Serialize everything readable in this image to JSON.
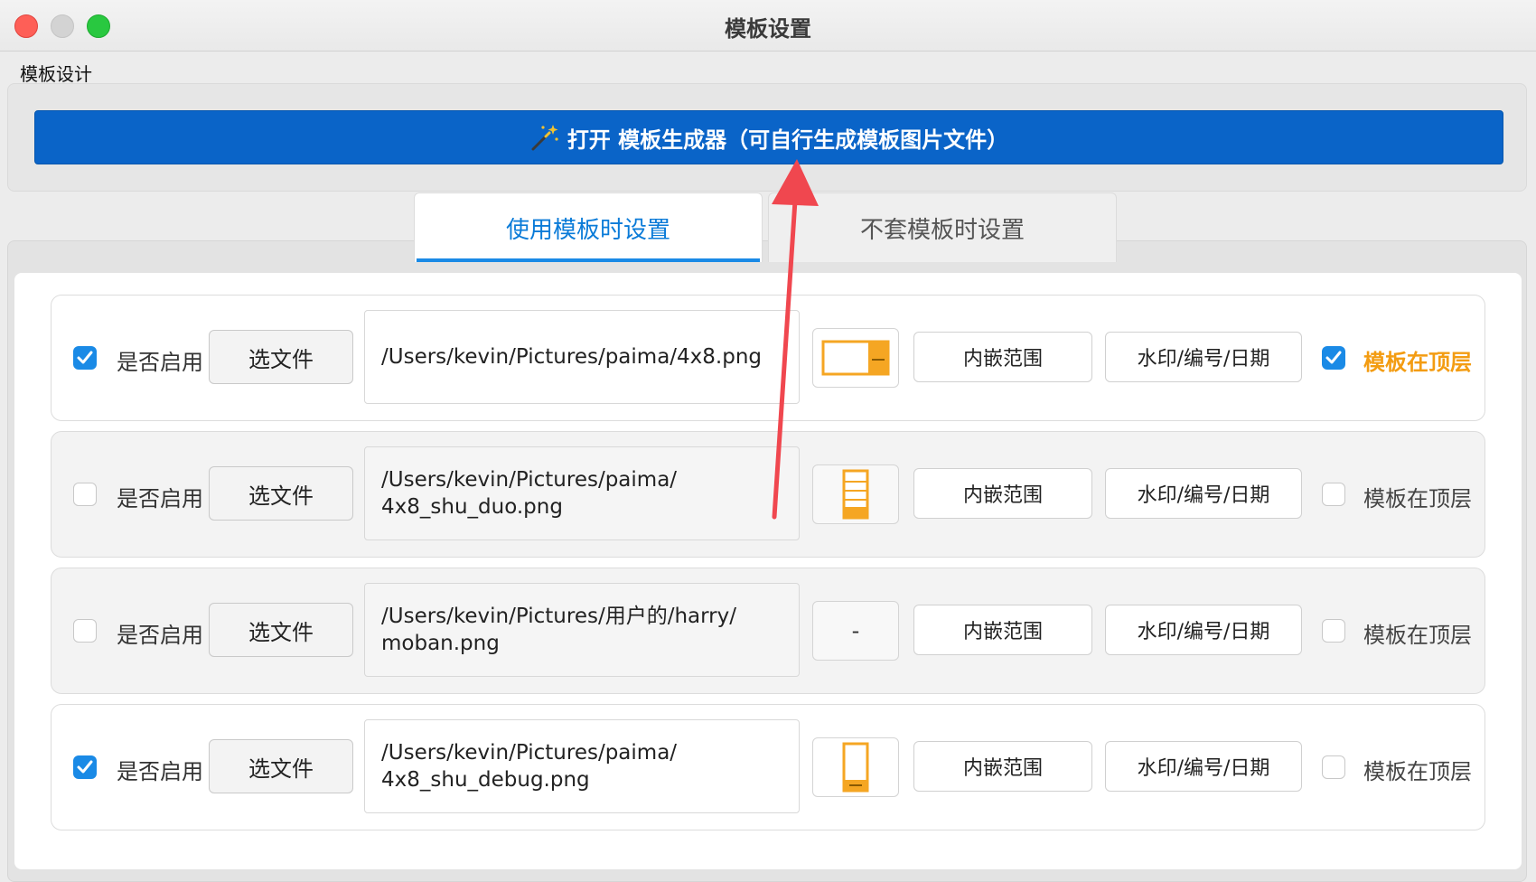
{
  "window": {
    "title": "模板设置"
  },
  "group_label": "模板设计",
  "generator_button": {
    "label": "打开 模板生成器（可自行生成模板图片文件）",
    "icon": "magic-wand-icon"
  },
  "tabs": [
    {
      "label": "使用模板时设置",
      "active": true
    },
    {
      "label": "不套模板时设置",
      "active": false
    }
  ],
  "rows": [
    {
      "enabled": true,
      "enable_label": "是否启用",
      "pick_label": "选文件",
      "path": "/Users/kevin/Pictures/paima/4x8.png",
      "thumb": "landscape-orange",
      "embed_label": "内嵌范围",
      "watermark_label": "水印/编号/日期",
      "on_top": true,
      "on_top_label": "模板在顶层"
    },
    {
      "enabled": false,
      "enable_label": "是否启用",
      "pick_label": "选文件",
      "path": "/Users/kevin/Pictures/paima/\n4x8_shu_duo.png",
      "thumb": "portrait-multi-orange",
      "embed_label": "内嵌范围",
      "watermark_label": "水印/编号/日期",
      "on_top": false,
      "on_top_label": "模板在顶层"
    },
    {
      "enabled": false,
      "enable_label": "是否启用",
      "pick_label": "选文件",
      "path": "/Users/kevin/Pictures/用户的/harry/\nmoban.png",
      "thumb_text": "-",
      "embed_label": "内嵌范围",
      "watermark_label": "水印/编号/日期",
      "on_top": false,
      "on_top_label": "模板在顶层"
    },
    {
      "enabled": true,
      "enable_label": "是否启用",
      "pick_label": "选文件",
      "path": "/Users/kevin/Pictures/paima/\n4x8_shu_debug.png",
      "thumb": "portrait-orange",
      "embed_label": "内嵌范围",
      "watermark_label": "水印/编号/日期",
      "on_top": false,
      "on_top_label": "模板在顶层"
    }
  ],
  "colors": {
    "accent": "#1a8ae6",
    "primary_button": "#0a64c8",
    "highlight": "#f39c12",
    "annotation_arrow": "#f0474f"
  }
}
